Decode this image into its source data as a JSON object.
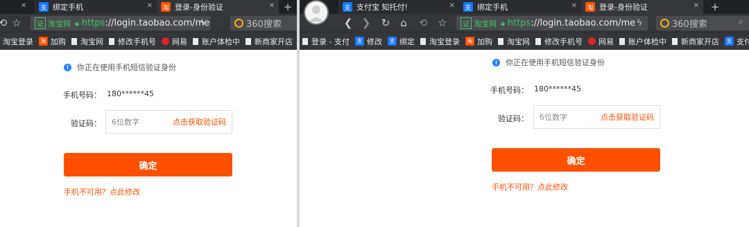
{
  "left": {
    "tabs": [
      {
        "label": "绑定手机",
        "icon": "alipay"
      },
      {
        "label": "登录-身份验证",
        "icon": "taobao"
      }
    ],
    "new_tab": "+",
    "url": {
      "ev_badge": "证",
      "ev_name": "淘宝网",
      "scheme": "https",
      "rest": "://login.taobao.com/me"
    },
    "search_placeholder": "360搜索",
    "bookmarks": [
      "淘宝登录",
      "加购",
      "淘宝网",
      "修改手机号",
      "网易",
      "账户体检中",
      "新商家开店"
    ],
    "form": {
      "info": "你正在使用手机短信验证身份",
      "phone_label": "手机号码：",
      "phone_value": "180******45",
      "code_label": "验证码：",
      "code_placeholder": "6位数字",
      "get_code": "点击获取验证码",
      "confirm": "确定",
      "unavailable": "手机不可用？点此修改"
    }
  },
  "right": {
    "tabs": [
      {
        "label": "支付宝 知托付!",
        "icon": "alipay"
      },
      {
        "label": "绑定手机",
        "icon": "alipay"
      },
      {
        "label": "登录-身份验证",
        "icon": "taobao"
      }
    ],
    "new_tab": "+",
    "url": {
      "ev_badge": "证",
      "ev_name": "淘宝网",
      "scheme": "https",
      "rest": "://login.taobao.com/me"
    },
    "search_placeholder": "360搜索",
    "bookmarks": [
      "登录 - 支付",
      "修改",
      "绑定",
      "淘宝登录",
      "加购",
      "淘宝网",
      "修改手机号",
      "网易",
      "账户体检中",
      "新商家开店",
      "支付宝"
    ],
    "form": {
      "info": "你正在使用手机短信验证身份",
      "phone_label": "手机号码：",
      "phone_value": "180******45",
      "code_label": "验证码：",
      "code_placeholder": "6位数字",
      "get_code": "点击获取验证码",
      "confirm": "确定",
      "unavailable": "手机不可用？点此修改"
    }
  },
  "colors": {
    "accent": "#ff5000",
    "secure": "#44c06b",
    "info": "#1e80ff",
    "alipay": "#1677ff"
  },
  "icons": [
    "back-icon",
    "forward-icon",
    "refresh-icon",
    "home-icon",
    "undo-icon",
    "star-icon",
    "lock-icon",
    "bolt-icon",
    "search-icon",
    "info-icon",
    "close-icon"
  ]
}
